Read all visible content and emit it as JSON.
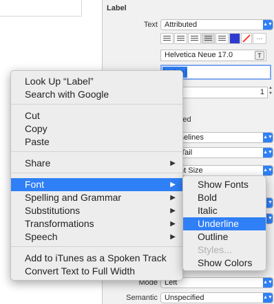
{
  "inspector": {
    "section_title": "Label",
    "text_label": "Text",
    "text_value": "Attributed",
    "font_value": "Helvetica Neue 17.0",
    "font_button": "T",
    "label_text": "Label",
    "lines_value": "1",
    "enabled_partial": "abled",
    "highlighted_partial": "ghlighted",
    "baseline_partial": "n Baselines",
    "truncate_partial": "cate Tail",
    "fontsize_partial": "d Font Size",
    "mode_label": "Mode",
    "mode_value": "Left",
    "semantic_label": "Semantic",
    "semantic_value": "Unspecified",
    "more_label": "···",
    "swatch_colors": [
      "#2f3bd0",
      "#ff3b30"
    ]
  },
  "context_menu": {
    "items": [
      {
        "label": "Look Up “Label”"
      },
      {
        "label": "Search with Google"
      },
      {
        "label": "Cut"
      },
      {
        "label": "Copy"
      },
      {
        "label": "Paste"
      },
      {
        "label": "Share",
        "submenu": true
      },
      {
        "label": "Font",
        "submenu": true,
        "highlighted": true
      },
      {
        "label": "Spelling and Grammar",
        "submenu": true
      },
      {
        "label": "Substitutions",
        "submenu": true
      },
      {
        "label": "Transformations",
        "submenu": true
      },
      {
        "label": "Speech",
        "submenu": true
      },
      {
        "label": "Add to iTunes as a Spoken Track"
      },
      {
        "label": "Convert Text to Full Width"
      }
    ]
  },
  "font_submenu": {
    "items": [
      {
        "label": "Show Fonts"
      },
      {
        "label": "Bold"
      },
      {
        "label": "Italic"
      },
      {
        "label": "Underline",
        "highlighted": true
      },
      {
        "label": "Outline"
      },
      {
        "label": "Styles...",
        "disabled": true
      },
      {
        "label": "Show Colors"
      }
    ]
  },
  "colors": {
    "accent": "#2f7ff6",
    "menu_bg": "#ededed",
    "panel_bg": "#f1f1f1"
  }
}
